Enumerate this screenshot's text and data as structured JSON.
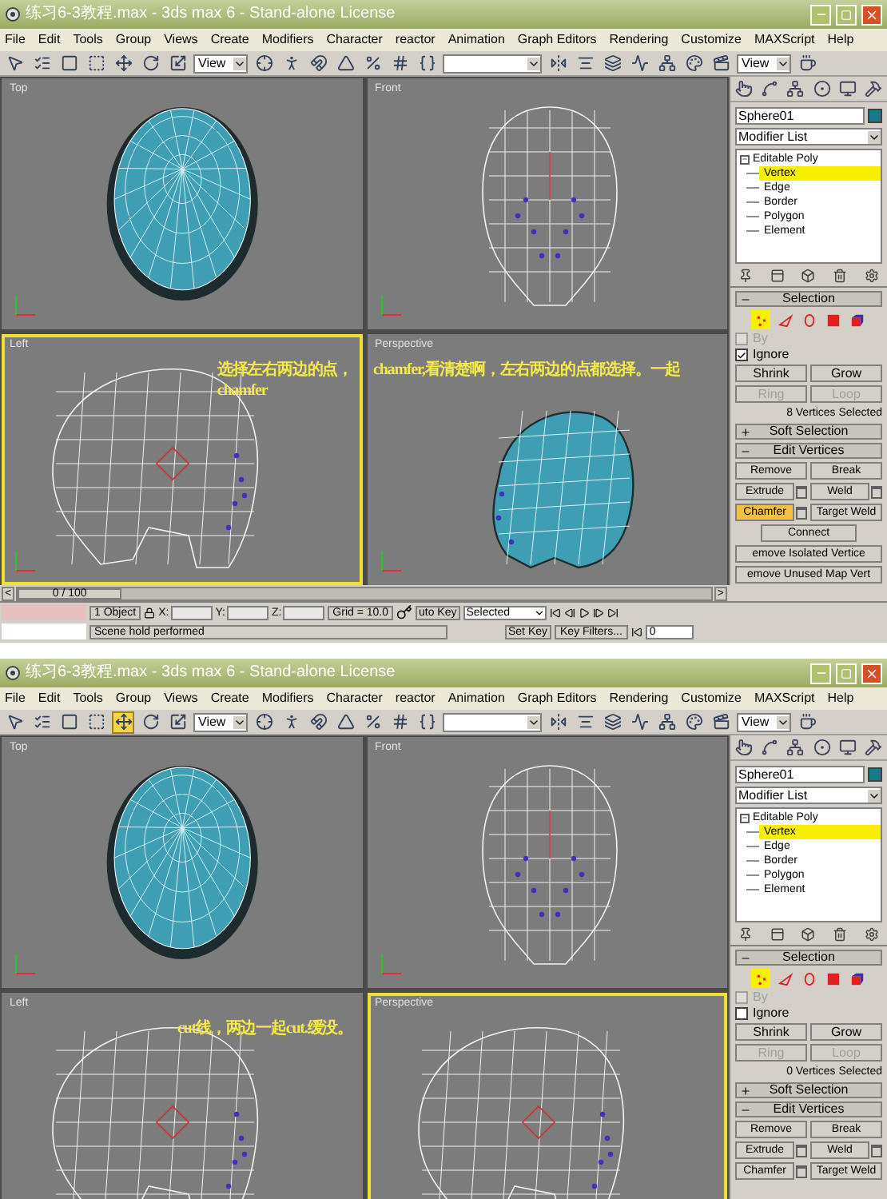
{
  "windows": [
    {
      "title": "练习6-3教程.max - 3ds max 6 - Stand-alone License",
      "menu": [
        "File",
        "Edit",
        "Tools",
        "Group",
        "Views",
        "Create",
        "Modifiers",
        "Character",
        "reactor",
        "Animation",
        "Graph Editors",
        "Rendering",
        "Customize",
        "MAXScript",
        "Help"
      ],
      "toolbar": [
        {
          "kind": "tool",
          "selected": false
        },
        {
          "kind": "tool",
          "selected": false
        },
        {
          "kind": "tool",
          "selected": false
        },
        {
          "kind": "tool",
          "selected": false
        },
        {
          "kind": "tool",
          "selected": false
        },
        {
          "kind": "tool",
          "selected": false
        },
        {
          "kind": "tool",
          "selected": false
        },
        {
          "kind": "dropdown",
          "value": "View"
        },
        {
          "kind": "tool",
          "selected": false
        },
        {
          "kind": "tool",
          "selected": false
        },
        {
          "kind": "tool",
          "selected": false
        },
        {
          "kind": "tool",
          "selected": false
        },
        {
          "kind": "tool",
          "selected": false
        },
        {
          "kind": "tool",
          "selected": false
        },
        {
          "kind": "tool",
          "selected": false
        },
        {
          "kind": "dropdown"
        },
        {
          "kind": "tool",
          "selected": false
        },
        {
          "kind": "tool",
          "selected": false
        },
        {
          "kind": "tool",
          "selected": false
        },
        {
          "kind": "tool",
          "selected": false
        },
        {
          "kind": "tool",
          "selected": false
        },
        {
          "kind": "tool",
          "selected": false
        },
        {
          "kind": "tool",
          "selected": false
        },
        {
          "kind": "dropdown",
          "value": "View"
        },
        {
          "kind": "tool",
          "selected": false
        }
      ],
      "viewports": [
        {
          "label": "Top",
          "active": false,
          "kind": "shaded-front"
        },
        {
          "label": "Front",
          "active": false,
          "kind": "wire-front"
        },
        {
          "label": "Left",
          "active": true,
          "kind": "wire-side",
          "note": [
            "选择左右两边的点，",
            "chamfer"
          ]
        },
        {
          "label": "Perspective",
          "active": false,
          "kind": "shaded-side",
          "note": [
            "chamfer,看清楚啊，左右两边的点都选择。一起"
          ]
        }
      ],
      "command_panel": {
        "object_name": "Sphere01",
        "modifier_list": "Modifier List",
        "stack": {
          "label": "Editable Poly",
          "expanded": true,
          "children": [
            {
              "label": "Vertex",
              "selected": true
            },
            {
              "label": "Edge",
              "selected": false
            },
            {
              "label": "Border",
              "selected": false
            },
            {
              "label": "Polygon",
              "selected": false
            },
            {
              "label": "Element",
              "selected": false
            }
          ]
        },
        "selection": {
          "title": "Selection",
          "expanded": true,
          "subobjects": [
            {
              "selected": true
            },
            {
              "selected": false
            },
            {
              "selected": false
            },
            {
              "selected": false
            },
            {
              "selected": false
            }
          ],
          "by": {
            "label": "By",
            "checked": false,
            "disabled": true
          },
          "ignore": {
            "label": "Ignore",
            "checked": true,
            "disabled": false
          },
          "buttons": [
            {
              "label": "Shrink",
              "disabled": false
            },
            {
              "label": "Grow",
              "disabled": false
            },
            {
              "label": "Ring",
              "disabled": true
            },
            {
              "label": "Loop",
              "disabled": true
            }
          ],
          "summary": "8 Vertices Selected"
        },
        "soft_selection": {
          "title": "Soft Selection",
          "expanded": false
        },
        "edit_vertices": {
          "title": "Edit Vertices",
          "expanded": true,
          "buttons": [
            {
              "label": "Remove",
              "kind": "half",
              "options": false,
              "selected": false
            },
            {
              "label": "Break",
              "kind": "half",
              "options": false,
              "selected": false
            },
            {
              "label": "Extrude",
              "kind": "half",
              "options": true,
              "selected": false
            },
            {
              "label": "Weld",
              "kind": "half",
              "options": true,
              "selected": false
            },
            {
              "label": "Chamfer",
              "kind": "half",
              "options": true,
              "selected": true
            },
            {
              "label": "Target Weld",
              "kind": "half",
              "options": false,
              "selected": false
            },
            {
              "label": "Connect",
              "kind": "center",
              "options": false,
              "selected": false
            },
            {
              "label": "emove Isolated Vertice",
              "kind": "full",
              "options": false,
              "selected": false
            },
            {
              "label": "emove Unused Map Vert",
              "kind": "full",
              "options": false,
              "selected": false
            }
          ]
        }
      },
      "time_slider": {
        "prev": "<",
        "reading": "0 / 100",
        "next": ">"
      },
      "status_bar": {
        "selection": "1 Object",
        "coords": [
          "X:",
          "Y:",
          "Z:"
        ],
        "grid": "Grid = 10.0",
        "auto_key": "uto Key",
        "key_mode": "Selected",
        "set_key": "Set Key",
        "key_filters": "Key Filters...",
        "frame": "0",
        "prompt": "Scene hold performed"
      }
    },
    {
      "title": "练习6-3教程.max - 3ds max 6 - Stand-alone License",
      "menu": [
        "File",
        "Edit",
        "Tools",
        "Group",
        "Views",
        "Create",
        "Modifiers",
        "Character",
        "reactor",
        "Animation",
        "Graph Editors",
        "Rendering",
        "Customize",
        "MAXScript",
        "Help"
      ],
      "toolbar": [
        {
          "kind": "tool",
          "selected": false
        },
        {
          "kind": "tool",
          "selected": false
        },
        {
          "kind": "tool",
          "selected": false
        },
        {
          "kind": "tool",
          "selected": false
        },
        {
          "kind": "tool",
          "selected": true
        },
        {
          "kind": "tool",
          "selected": false
        },
        {
          "kind": "tool",
          "selected": false
        },
        {
          "kind": "dropdown",
          "value": "View"
        },
        {
          "kind": "tool",
          "selected": false
        },
        {
          "kind": "tool",
          "selected": false
        },
        {
          "kind": "tool",
          "selected": false
        },
        {
          "kind": "tool",
          "selected": false
        },
        {
          "kind": "tool",
          "selected": false
        },
        {
          "kind": "tool",
          "selected": false
        },
        {
          "kind": "tool",
          "selected": false
        },
        {
          "kind": "dropdown"
        },
        {
          "kind": "tool",
          "selected": false
        },
        {
          "kind": "tool",
          "selected": false
        },
        {
          "kind": "tool",
          "selected": false
        },
        {
          "kind": "tool",
          "selected": false
        },
        {
          "kind": "tool",
          "selected": false
        },
        {
          "kind": "tool",
          "selected": false
        },
        {
          "kind": "tool",
          "selected": false
        },
        {
          "kind": "dropdown",
          "value": "View"
        },
        {
          "kind": "tool",
          "selected": false
        }
      ],
      "viewports": [
        {
          "label": "Top",
          "active": false,
          "kind": "shaded-front"
        },
        {
          "label": "Front",
          "active": false,
          "kind": "wire-front"
        },
        {
          "label": "Left",
          "active": false,
          "kind": "wire-side",
          "note": [
            "cut线，两边一起cut.缓没。"
          ]
        },
        {
          "label": "Perspective",
          "active": true,
          "kind": "wire-side"
        }
      ],
      "command_panel": {
        "object_name": "Sphere01",
        "modifier_list": "Modifier List",
        "stack": {
          "label": "Editable Poly",
          "expanded": true,
          "children": [
            {
              "label": "Vertex",
              "selected": true
            },
            {
              "label": "Edge",
              "selected": false
            },
            {
              "label": "Border",
              "selected": false
            },
            {
              "label": "Polygon",
              "selected": false
            },
            {
              "label": "Element",
              "selected": false
            }
          ]
        },
        "selection": {
          "title": "Selection",
          "expanded": true,
          "subobjects": [
            {
              "selected": true
            },
            {
              "selected": false
            },
            {
              "selected": false
            },
            {
              "selected": false
            },
            {
              "selected": false
            }
          ],
          "by": {
            "label": "By",
            "checked": false,
            "disabled": true
          },
          "ignore": {
            "label": "Ignore",
            "checked": false,
            "disabled": false
          },
          "buttons": [
            {
              "label": "Shrink",
              "disabled": false
            },
            {
              "label": "Grow",
              "disabled": false
            },
            {
              "label": "Ring",
              "disabled": true
            },
            {
              "label": "Loop",
              "disabled": true
            }
          ],
          "summary": "0 Vertices Selected"
        },
        "soft_selection": {
          "title": "Soft Selection",
          "expanded": false
        },
        "edit_vertices": {
          "title": "Edit Vertices",
          "expanded": true,
          "buttons": [
            {
              "label": "Remove",
              "kind": "half",
              "options": false,
              "selected": false
            },
            {
              "label": "Break",
              "kind": "half",
              "options": false,
              "selected": false
            },
            {
              "label": "Extrude",
              "kind": "half",
              "options": true,
              "selected": false
            },
            {
              "label": "Weld",
              "kind": "half",
              "options": true,
              "selected": false
            },
            {
              "label": "Chamfer",
              "kind": "half",
              "options": true,
              "selected": false
            },
            {
              "label": "Target Weld",
              "kind": "half",
              "options": false,
              "selected": false
            }
          ]
        }
      }
    }
  ]
}
